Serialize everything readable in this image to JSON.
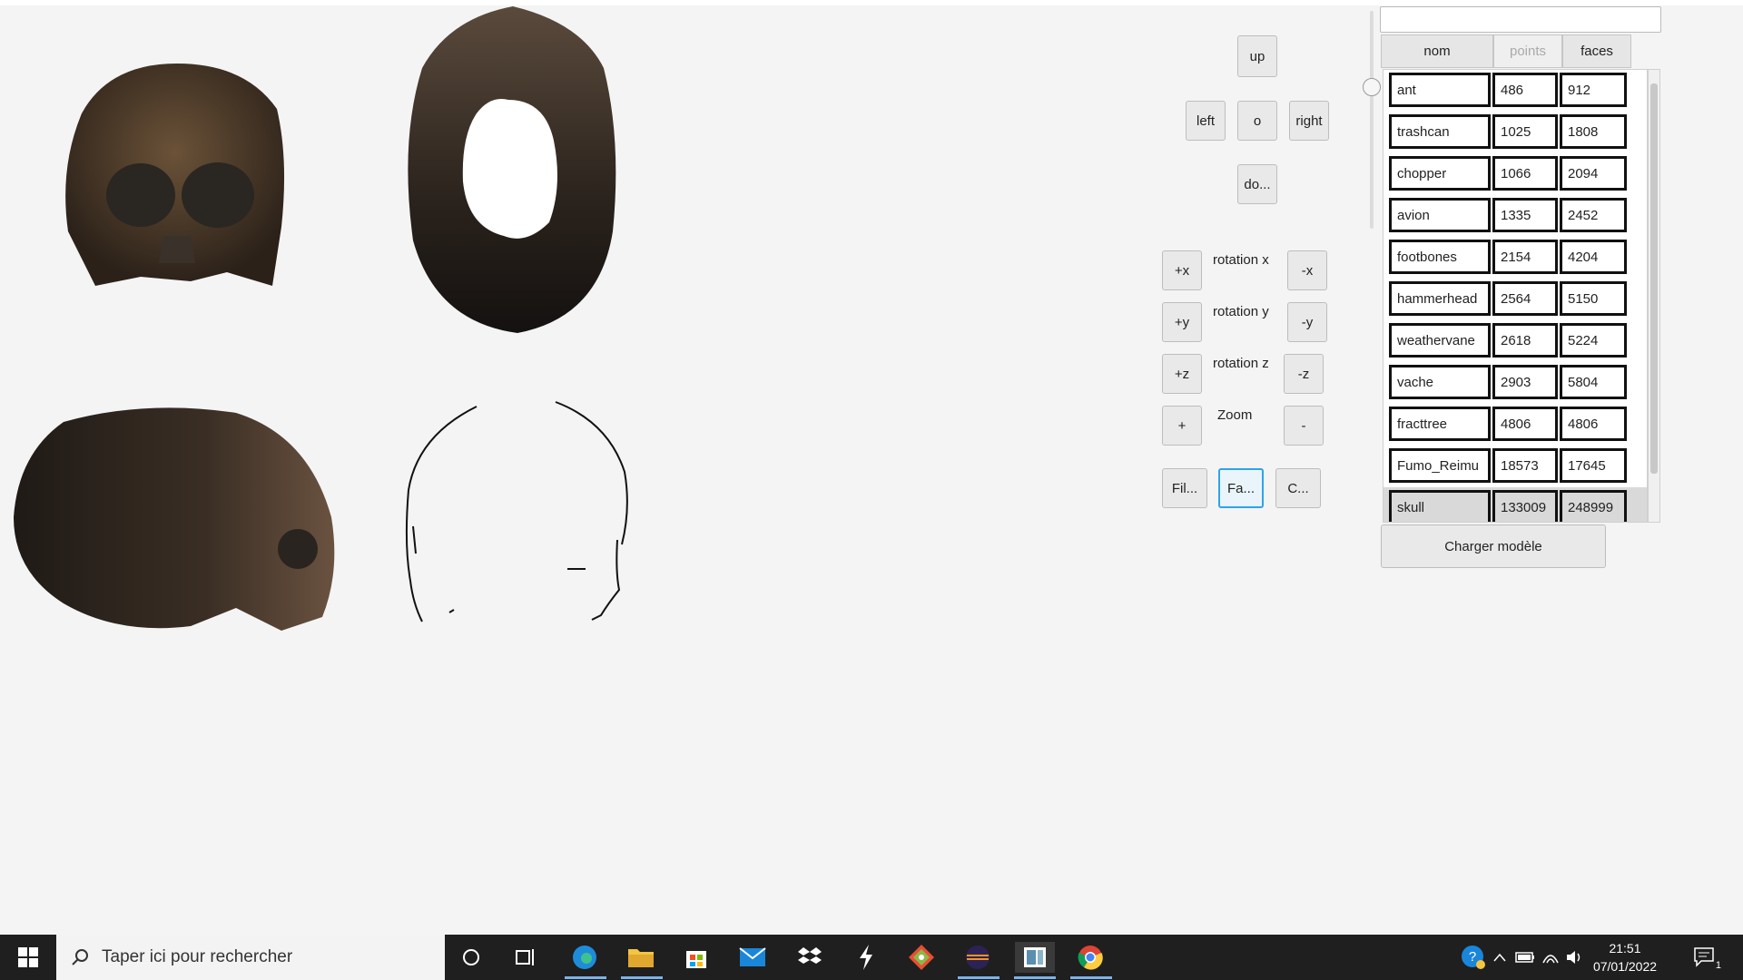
{
  "controls": {
    "up": "up",
    "left": "left",
    "center": "o",
    "right": "right",
    "down": "do...",
    "plus_x": "+x",
    "rot_x": "rotation x",
    "minus_x": "-x",
    "plus_y": "+y",
    "rot_y": "rotation y",
    "minus_y": "-y",
    "plus_z": "+z",
    "rot_z": "rotation z",
    "minus_z": "-z",
    "zoom_in": "+",
    "zoom": "Zoom",
    "zoom_out": "-",
    "fil": "Fil...",
    "fa": "Fa...",
    "c": "C..."
  },
  "table": {
    "search_value": "",
    "headers": [
      "nom",
      "points",
      "faces"
    ],
    "rows": [
      [
        "ant",
        "486",
        "912"
      ],
      [
        "trashcan",
        "1025",
        "1808"
      ],
      [
        "chopper",
        "1066",
        "2094"
      ],
      [
        "avion",
        "1335",
        "2452"
      ],
      [
        "footbones",
        "2154",
        "4204"
      ],
      [
        "hammerhead",
        "2564",
        "5150"
      ],
      [
        "weathervane",
        "2618",
        "5224"
      ],
      [
        "vache",
        "2903",
        "5804"
      ],
      [
        "fracttree",
        "4806",
        "4806"
      ],
      [
        "Fumo_Reimu",
        "18573",
        "17645"
      ],
      [
        "skull",
        "133009",
        "248999"
      ]
    ],
    "selected_row": "skull",
    "load_button": "Charger modèle"
  },
  "taskbar": {
    "search_placeholder": "Taper ici pour rechercher",
    "time": "21:51",
    "date": "07/01/2022",
    "notification_count": "1",
    "icons": [
      "windows-start-icon",
      "cortana-icon",
      "task-view-icon",
      "edge-icon",
      "file-explorer-icon",
      "store-icon",
      "mail-icon",
      "dropbox-icon",
      "app-icon",
      "git-icon",
      "eclipse-icon",
      "java-app-icon",
      "chrome-icon"
    ]
  },
  "colors": {
    "accent": "#2ea4e8",
    "taskbar": "#1f1f1f",
    "skull": "#4a3a2a"
  }
}
